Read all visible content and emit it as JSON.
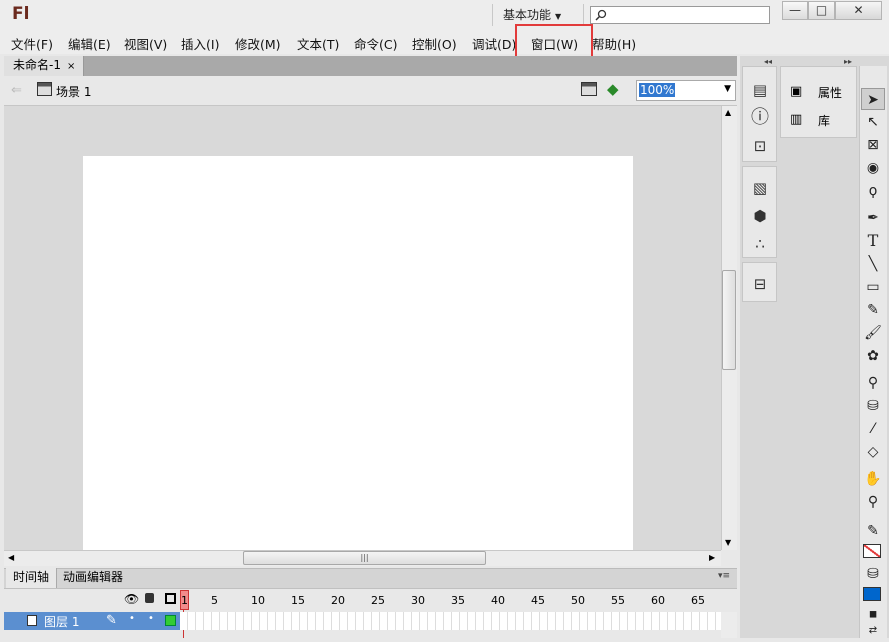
{
  "app": {
    "logo": "Fl",
    "workspace": "基本功能"
  },
  "window_buttons": {
    "minimize": "—",
    "maximize": "□",
    "close": "✕"
  },
  "menu": [
    {
      "label": "文件(F)"
    },
    {
      "label": "编辑(E)"
    },
    {
      "label": "视图(V)"
    },
    {
      "label": "插入(I)"
    },
    {
      "label": "修改(M)"
    },
    {
      "label": "文本(T)"
    },
    {
      "label": "命令(C)"
    },
    {
      "label": "控制(O)"
    },
    {
      "label": "调试(D)"
    },
    {
      "label": "窗口(W)"
    },
    {
      "label": "帮助(H)"
    }
  ],
  "document": {
    "tab_label": "未命名-1",
    "tab_close": "×",
    "scene": "场景 1",
    "zoom": "100%"
  },
  "timeline": {
    "tabs": [
      "时间轴",
      "动画编辑器"
    ],
    "frame_numbers": [
      "1",
      "5",
      "10",
      "15",
      "20",
      "25",
      "30",
      "35",
      "40",
      "45",
      "50",
      "55",
      "60",
      "65"
    ],
    "layer_name": "图层 1"
  },
  "panels": {
    "properties": "属性",
    "library": "库"
  },
  "colors": {
    "highlight_box": "#e23b3b",
    "layer_row": "#5b8fd0",
    "fill_color": "#0066cc"
  }
}
